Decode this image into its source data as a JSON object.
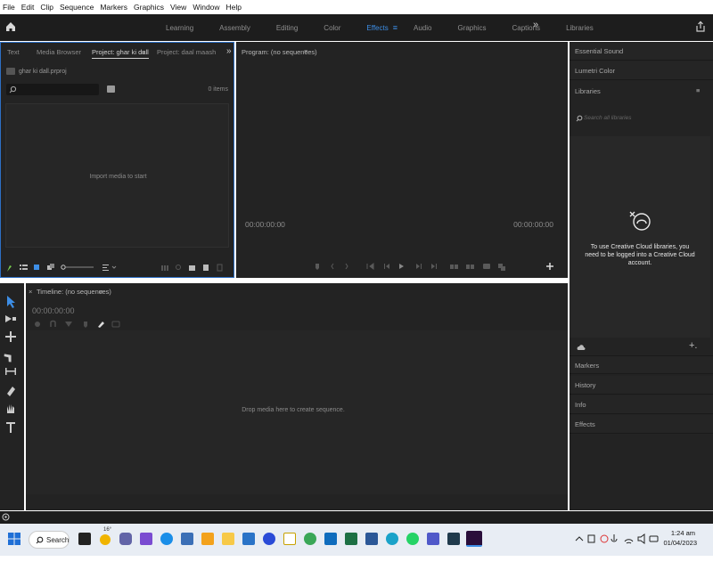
{
  "menu": [
    "File",
    "Edit",
    "Clip",
    "Sequence",
    "Markers",
    "Graphics",
    "View",
    "Window",
    "Help"
  ],
  "workspaces": [
    "Learning",
    "Assembly",
    "Editing",
    "Color",
    "Effects",
    "Audio",
    "Graphics",
    "Captions",
    "Libraries"
  ],
  "active_workspace": "Effects",
  "project_panel": {
    "tabs": [
      "Text",
      "Media Browser",
      "Project: ghar ki dall",
      "Project: daal maash"
    ],
    "file": "ghar ki dall.prproj",
    "items_count": "0 items",
    "import_message": "Import media to start"
  },
  "program": {
    "title": "Program: (no sequences)",
    "timecode_left": "00:00:00:00",
    "timecode_right": "00:00:00:00"
  },
  "right_panels": {
    "essential_sound": "Essential Sound",
    "lumetri_color": "Lumetri Color",
    "libraries": "Libraries",
    "search_placeholder": "Search all libraries",
    "cc_message": "To use Creative Cloud libraries, you need to be logged into a Creative Cloud account.",
    "markers": "Markers",
    "history": "History",
    "info": "Info",
    "effects": "Effects"
  },
  "timeline": {
    "title": "Timeline: (no sequences)",
    "timecode": "00:00:00:00",
    "drop_message": "Drop media here to create sequence."
  },
  "taskbar": {
    "search_label": "Search",
    "weather_temp": "16°",
    "time": "1:24 am",
    "date": "01/04/2023"
  },
  "colors": {
    "accent": "#3d8ee6",
    "panel": "#232323",
    "taskbar": "#e8edf4"
  }
}
